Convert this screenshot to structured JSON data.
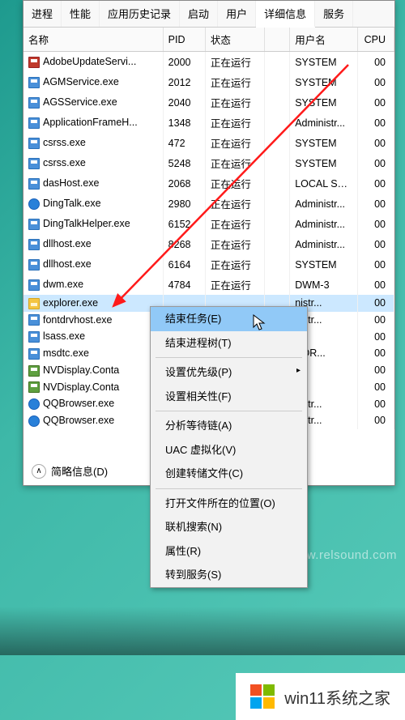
{
  "tabs": [
    "进程",
    "性能",
    "应用历史记录",
    "启动",
    "用户",
    "详细信息",
    "服务"
  ],
  "active_tab_index": 5,
  "columns": [
    "名称",
    "PID",
    "状态",
    "",
    "用户名",
    "CPU"
  ],
  "processes": [
    {
      "name": "AdobeUpdateServi...",
      "pid": "2000",
      "status": "正在运行",
      "user": "SYSTEM",
      "cpu": "00",
      "icon": "red"
    },
    {
      "name": "AGMService.exe",
      "pid": "2012",
      "status": "正在运行",
      "user": "SYSTEM",
      "cpu": "00",
      "icon": "app"
    },
    {
      "name": "AGSService.exe",
      "pid": "2040",
      "status": "正在运行",
      "user": "SYSTEM",
      "cpu": "00",
      "icon": "app"
    },
    {
      "name": "ApplicationFrameH...",
      "pid": "1348",
      "status": "正在运行",
      "user": "Administr...",
      "cpu": "00",
      "icon": "app"
    },
    {
      "name": "csrss.exe",
      "pid": "472",
      "status": "正在运行",
      "user": "SYSTEM",
      "cpu": "00",
      "icon": "app"
    },
    {
      "name": "csrss.exe",
      "pid": "5248",
      "status": "正在运行",
      "user": "SYSTEM",
      "cpu": "00",
      "icon": "app"
    },
    {
      "name": "dasHost.exe",
      "pid": "2068",
      "status": "正在运行",
      "user": "LOCAL SE...",
      "cpu": "00",
      "icon": "app"
    },
    {
      "name": "DingTalk.exe",
      "pid": "2980",
      "status": "正在运行",
      "user": "Administr...",
      "cpu": "00",
      "icon": "blue"
    },
    {
      "name": "DingTalkHelper.exe",
      "pid": "6152",
      "status": "正在运行",
      "user": "Administr...",
      "cpu": "00",
      "icon": "app"
    },
    {
      "name": "dllhost.exe",
      "pid": "8268",
      "status": "正在运行",
      "user": "Administr...",
      "cpu": "00",
      "icon": "app"
    },
    {
      "name": "dllhost.exe",
      "pid": "6164",
      "status": "正在运行",
      "user": "SYSTEM",
      "cpu": "00",
      "icon": "app"
    },
    {
      "name": "dwm.exe",
      "pid": "4784",
      "status": "正在运行",
      "user": "DWM-3",
      "cpu": "00",
      "icon": "app"
    },
    {
      "name": "explorer.exe",
      "pid": "",
      "status": "",
      "user": "nistr...",
      "cpu": "00",
      "icon": "folder",
      "selected": true
    },
    {
      "name": "fontdrvhost.exe",
      "pid": "",
      "status": "",
      "user": "nistr...",
      "cpu": "00",
      "icon": "app"
    },
    {
      "name": "lsass.exe",
      "pid": "",
      "status": "",
      "user": "M",
      "cpu": "00",
      "icon": "app"
    },
    {
      "name": "msdtc.exe",
      "pid": "",
      "status": "",
      "user": "VOR...",
      "cpu": "00",
      "icon": "app"
    },
    {
      "name": "NVDisplay.Conta",
      "pid": "",
      "status": "",
      "user": "M",
      "cpu": "00",
      "icon": "green"
    },
    {
      "name": "NVDisplay.Conta",
      "pid": "",
      "status": "",
      "user": "M",
      "cpu": "00",
      "icon": "green"
    },
    {
      "name": "QQBrowser.exe",
      "pid": "",
      "status": "",
      "user": "nistr...",
      "cpu": "00",
      "icon": "blue"
    },
    {
      "name": "QQBrowser.exe",
      "pid": "",
      "status": "",
      "user": "nistr...",
      "cpu": "00",
      "icon": "blue"
    }
  ],
  "context_menu": {
    "groups": [
      [
        {
          "label": "结束任务(E)",
          "hover": true
        },
        {
          "label": "结束进程树(T)"
        }
      ],
      [
        {
          "label": "设置优先级(P)",
          "submenu": true
        },
        {
          "label": "设置相关性(F)"
        }
      ],
      [
        {
          "label": "分析等待链(A)"
        },
        {
          "label": "UAC 虚拟化(V)"
        },
        {
          "label": "创建转储文件(C)"
        }
      ],
      [
        {
          "label": "打开文件所在的位置(O)"
        },
        {
          "label": "联机搜索(N)"
        },
        {
          "label": "属性(R)"
        },
        {
          "label": "转到服务(S)"
        }
      ]
    ]
  },
  "footer_label": "简略信息(D)",
  "watermark": "www.relsound.com",
  "corner_text": "win11系统之家"
}
